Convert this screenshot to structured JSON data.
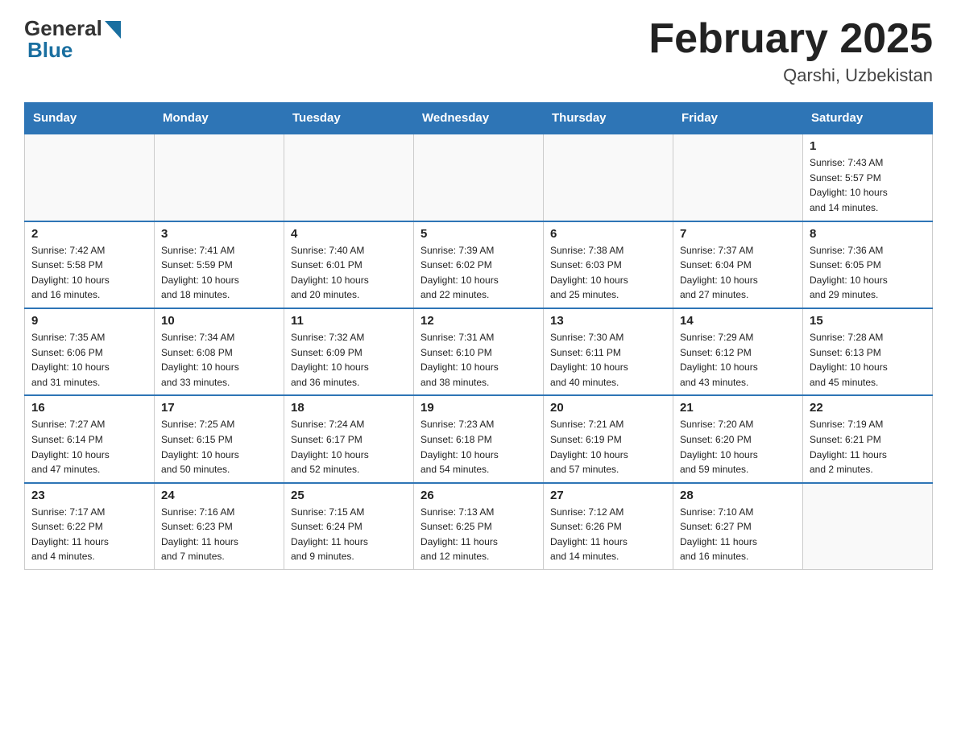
{
  "header": {
    "title": "February 2025",
    "subtitle": "Qarshi, Uzbekistan",
    "logo_general": "General",
    "logo_blue": "Blue"
  },
  "days_of_week": [
    "Sunday",
    "Monday",
    "Tuesday",
    "Wednesday",
    "Thursday",
    "Friday",
    "Saturday"
  ],
  "weeks": [
    [
      {
        "day": "",
        "info": ""
      },
      {
        "day": "",
        "info": ""
      },
      {
        "day": "",
        "info": ""
      },
      {
        "day": "",
        "info": ""
      },
      {
        "day": "",
        "info": ""
      },
      {
        "day": "",
        "info": ""
      },
      {
        "day": "1",
        "info": "Sunrise: 7:43 AM\nSunset: 5:57 PM\nDaylight: 10 hours\nand 14 minutes."
      }
    ],
    [
      {
        "day": "2",
        "info": "Sunrise: 7:42 AM\nSunset: 5:58 PM\nDaylight: 10 hours\nand 16 minutes."
      },
      {
        "day": "3",
        "info": "Sunrise: 7:41 AM\nSunset: 5:59 PM\nDaylight: 10 hours\nand 18 minutes."
      },
      {
        "day": "4",
        "info": "Sunrise: 7:40 AM\nSunset: 6:01 PM\nDaylight: 10 hours\nand 20 minutes."
      },
      {
        "day": "5",
        "info": "Sunrise: 7:39 AM\nSunset: 6:02 PM\nDaylight: 10 hours\nand 22 minutes."
      },
      {
        "day": "6",
        "info": "Sunrise: 7:38 AM\nSunset: 6:03 PM\nDaylight: 10 hours\nand 25 minutes."
      },
      {
        "day": "7",
        "info": "Sunrise: 7:37 AM\nSunset: 6:04 PM\nDaylight: 10 hours\nand 27 minutes."
      },
      {
        "day": "8",
        "info": "Sunrise: 7:36 AM\nSunset: 6:05 PM\nDaylight: 10 hours\nand 29 minutes."
      }
    ],
    [
      {
        "day": "9",
        "info": "Sunrise: 7:35 AM\nSunset: 6:06 PM\nDaylight: 10 hours\nand 31 minutes."
      },
      {
        "day": "10",
        "info": "Sunrise: 7:34 AM\nSunset: 6:08 PM\nDaylight: 10 hours\nand 33 minutes."
      },
      {
        "day": "11",
        "info": "Sunrise: 7:32 AM\nSunset: 6:09 PM\nDaylight: 10 hours\nand 36 minutes."
      },
      {
        "day": "12",
        "info": "Sunrise: 7:31 AM\nSunset: 6:10 PM\nDaylight: 10 hours\nand 38 minutes."
      },
      {
        "day": "13",
        "info": "Sunrise: 7:30 AM\nSunset: 6:11 PM\nDaylight: 10 hours\nand 40 minutes."
      },
      {
        "day": "14",
        "info": "Sunrise: 7:29 AM\nSunset: 6:12 PM\nDaylight: 10 hours\nand 43 minutes."
      },
      {
        "day": "15",
        "info": "Sunrise: 7:28 AM\nSunset: 6:13 PM\nDaylight: 10 hours\nand 45 minutes."
      }
    ],
    [
      {
        "day": "16",
        "info": "Sunrise: 7:27 AM\nSunset: 6:14 PM\nDaylight: 10 hours\nand 47 minutes."
      },
      {
        "day": "17",
        "info": "Sunrise: 7:25 AM\nSunset: 6:15 PM\nDaylight: 10 hours\nand 50 minutes."
      },
      {
        "day": "18",
        "info": "Sunrise: 7:24 AM\nSunset: 6:17 PM\nDaylight: 10 hours\nand 52 minutes."
      },
      {
        "day": "19",
        "info": "Sunrise: 7:23 AM\nSunset: 6:18 PM\nDaylight: 10 hours\nand 54 minutes."
      },
      {
        "day": "20",
        "info": "Sunrise: 7:21 AM\nSunset: 6:19 PM\nDaylight: 10 hours\nand 57 minutes."
      },
      {
        "day": "21",
        "info": "Sunrise: 7:20 AM\nSunset: 6:20 PM\nDaylight: 10 hours\nand 59 minutes."
      },
      {
        "day": "22",
        "info": "Sunrise: 7:19 AM\nSunset: 6:21 PM\nDaylight: 11 hours\nand 2 minutes."
      }
    ],
    [
      {
        "day": "23",
        "info": "Sunrise: 7:17 AM\nSunset: 6:22 PM\nDaylight: 11 hours\nand 4 minutes."
      },
      {
        "day": "24",
        "info": "Sunrise: 7:16 AM\nSunset: 6:23 PM\nDaylight: 11 hours\nand 7 minutes."
      },
      {
        "day": "25",
        "info": "Sunrise: 7:15 AM\nSunset: 6:24 PM\nDaylight: 11 hours\nand 9 minutes."
      },
      {
        "day": "26",
        "info": "Sunrise: 7:13 AM\nSunset: 6:25 PM\nDaylight: 11 hours\nand 12 minutes."
      },
      {
        "day": "27",
        "info": "Sunrise: 7:12 AM\nSunset: 6:26 PM\nDaylight: 11 hours\nand 14 minutes."
      },
      {
        "day": "28",
        "info": "Sunrise: 7:10 AM\nSunset: 6:27 PM\nDaylight: 11 hours\nand 16 minutes."
      },
      {
        "day": "",
        "info": ""
      }
    ]
  ]
}
